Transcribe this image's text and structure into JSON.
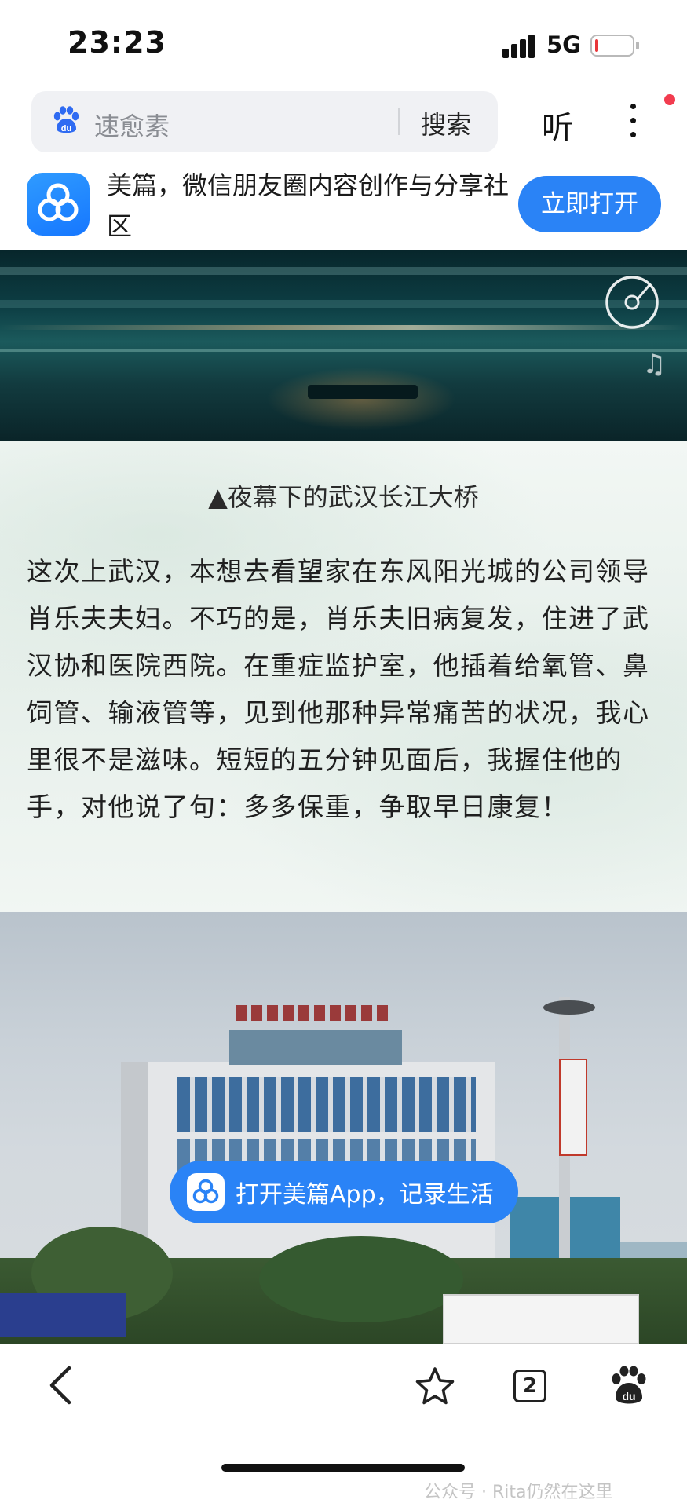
{
  "status_bar": {
    "time": "23:23",
    "network": "5G",
    "battery_level": 0.08,
    "battery_color": "#e8363a"
  },
  "browser": {
    "search_query": "速愈素",
    "search_button": "搜索",
    "listen_button": "听",
    "search_icon": "baidu-paw-icon",
    "menu_icon": "more-vertical-icon",
    "notification_dot_color": "#f23c4f"
  },
  "app_banner": {
    "title": "美篇，微信朋友圈内容创作与分享社区",
    "open_button": "立即打开",
    "accent": "#2a83f6"
  },
  "article": {
    "caption": "▲夜幕下的武汉长江大桥",
    "paragraph": "这次上武汉，本想去看望家在东风阳光城的公司领导肖乐夫夫妇。不巧的是，肖乐夫旧病复发，住进了武汉协和医院西院。在重症监护室，他插着给氧管、鼻饲管、输液管等，见到他那种异常痛苦的状况，我心里很不是滋味。短短的五分钟见面后，我握住他的手，对他说了句：多多保重，争取早日康复！",
    "music_icon": "music-disc-icon",
    "open_app_pill": "打开美篇App，记录生活"
  },
  "bottom_nav": {
    "tab_count": "2",
    "watermark": "公众号 · Rita仍然在这里"
  }
}
